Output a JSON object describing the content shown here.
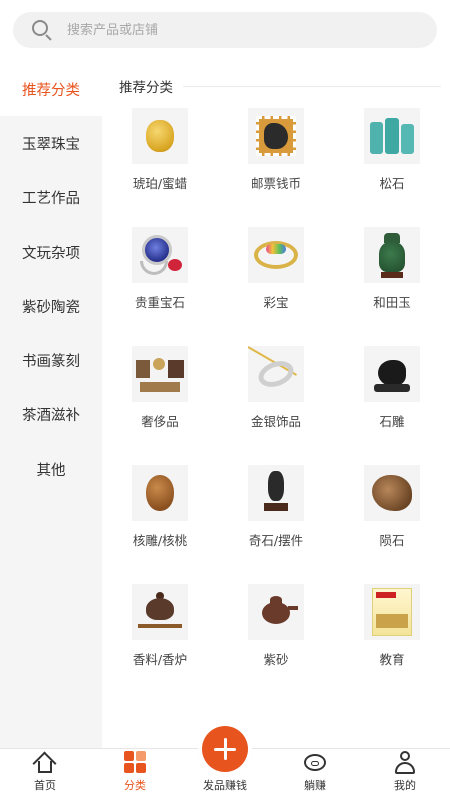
{
  "search": {
    "placeholder": "搜索产品或店铺"
  },
  "sidebar": {
    "items": [
      {
        "label": "推荐分类",
        "active": true
      },
      {
        "label": "玉翠珠宝"
      },
      {
        "label": "工艺作品"
      },
      {
        "label": "文玩杂项"
      },
      {
        "label": "紫砂陶瓷"
      },
      {
        "label": "书画篆刻"
      },
      {
        "label": "茶酒滋补"
      },
      {
        "label": "其他"
      }
    ]
  },
  "main": {
    "section_title": "推荐分类",
    "categories": [
      {
        "label": "琥珀/蜜蜡",
        "icon": "amber-image"
      },
      {
        "label": "邮票钱币",
        "icon": "stamp-image"
      },
      {
        "label": "松石",
        "icon": "turquoise-image"
      },
      {
        "label": "贵重宝石",
        "icon": "gemstone-ring-image"
      },
      {
        "label": "彩宝",
        "icon": "colored-gem-bangle-image"
      },
      {
        "label": "和田玉",
        "icon": "jade-vase-image"
      },
      {
        "label": "奢侈品",
        "icon": "luxury-goods-image"
      },
      {
        "label": "金银饰品",
        "icon": "silver-bangle-image"
      },
      {
        "label": "石雕",
        "icon": "stone-carving-image"
      },
      {
        "label": "核雕/核桃",
        "icon": "walnut-image"
      },
      {
        "label": "奇石/摆件",
        "icon": "rock-ornament-image"
      },
      {
        "label": "陨石",
        "icon": "meteorite-image"
      },
      {
        "label": "香料/香炉",
        "icon": "incense-burner-image"
      },
      {
        "label": "紫砂",
        "icon": "teapot-image"
      },
      {
        "label": "教育",
        "icon": "education-book-image"
      }
    ]
  },
  "bottom_nav": {
    "items": [
      {
        "label": "首页",
        "icon": "home-icon"
      },
      {
        "label": "分类",
        "icon": "category-icon",
        "active": true
      },
      {
        "label": "发品赚钱",
        "icon": "plus-icon"
      },
      {
        "label": "躺赚",
        "icon": "piggy-bank-icon"
      },
      {
        "label": "我的",
        "icon": "user-icon"
      }
    ]
  },
  "colors": {
    "accent": "#e8541e",
    "sidebar_bg": "#f5f5f5",
    "search_bg": "#f1f1f1"
  }
}
